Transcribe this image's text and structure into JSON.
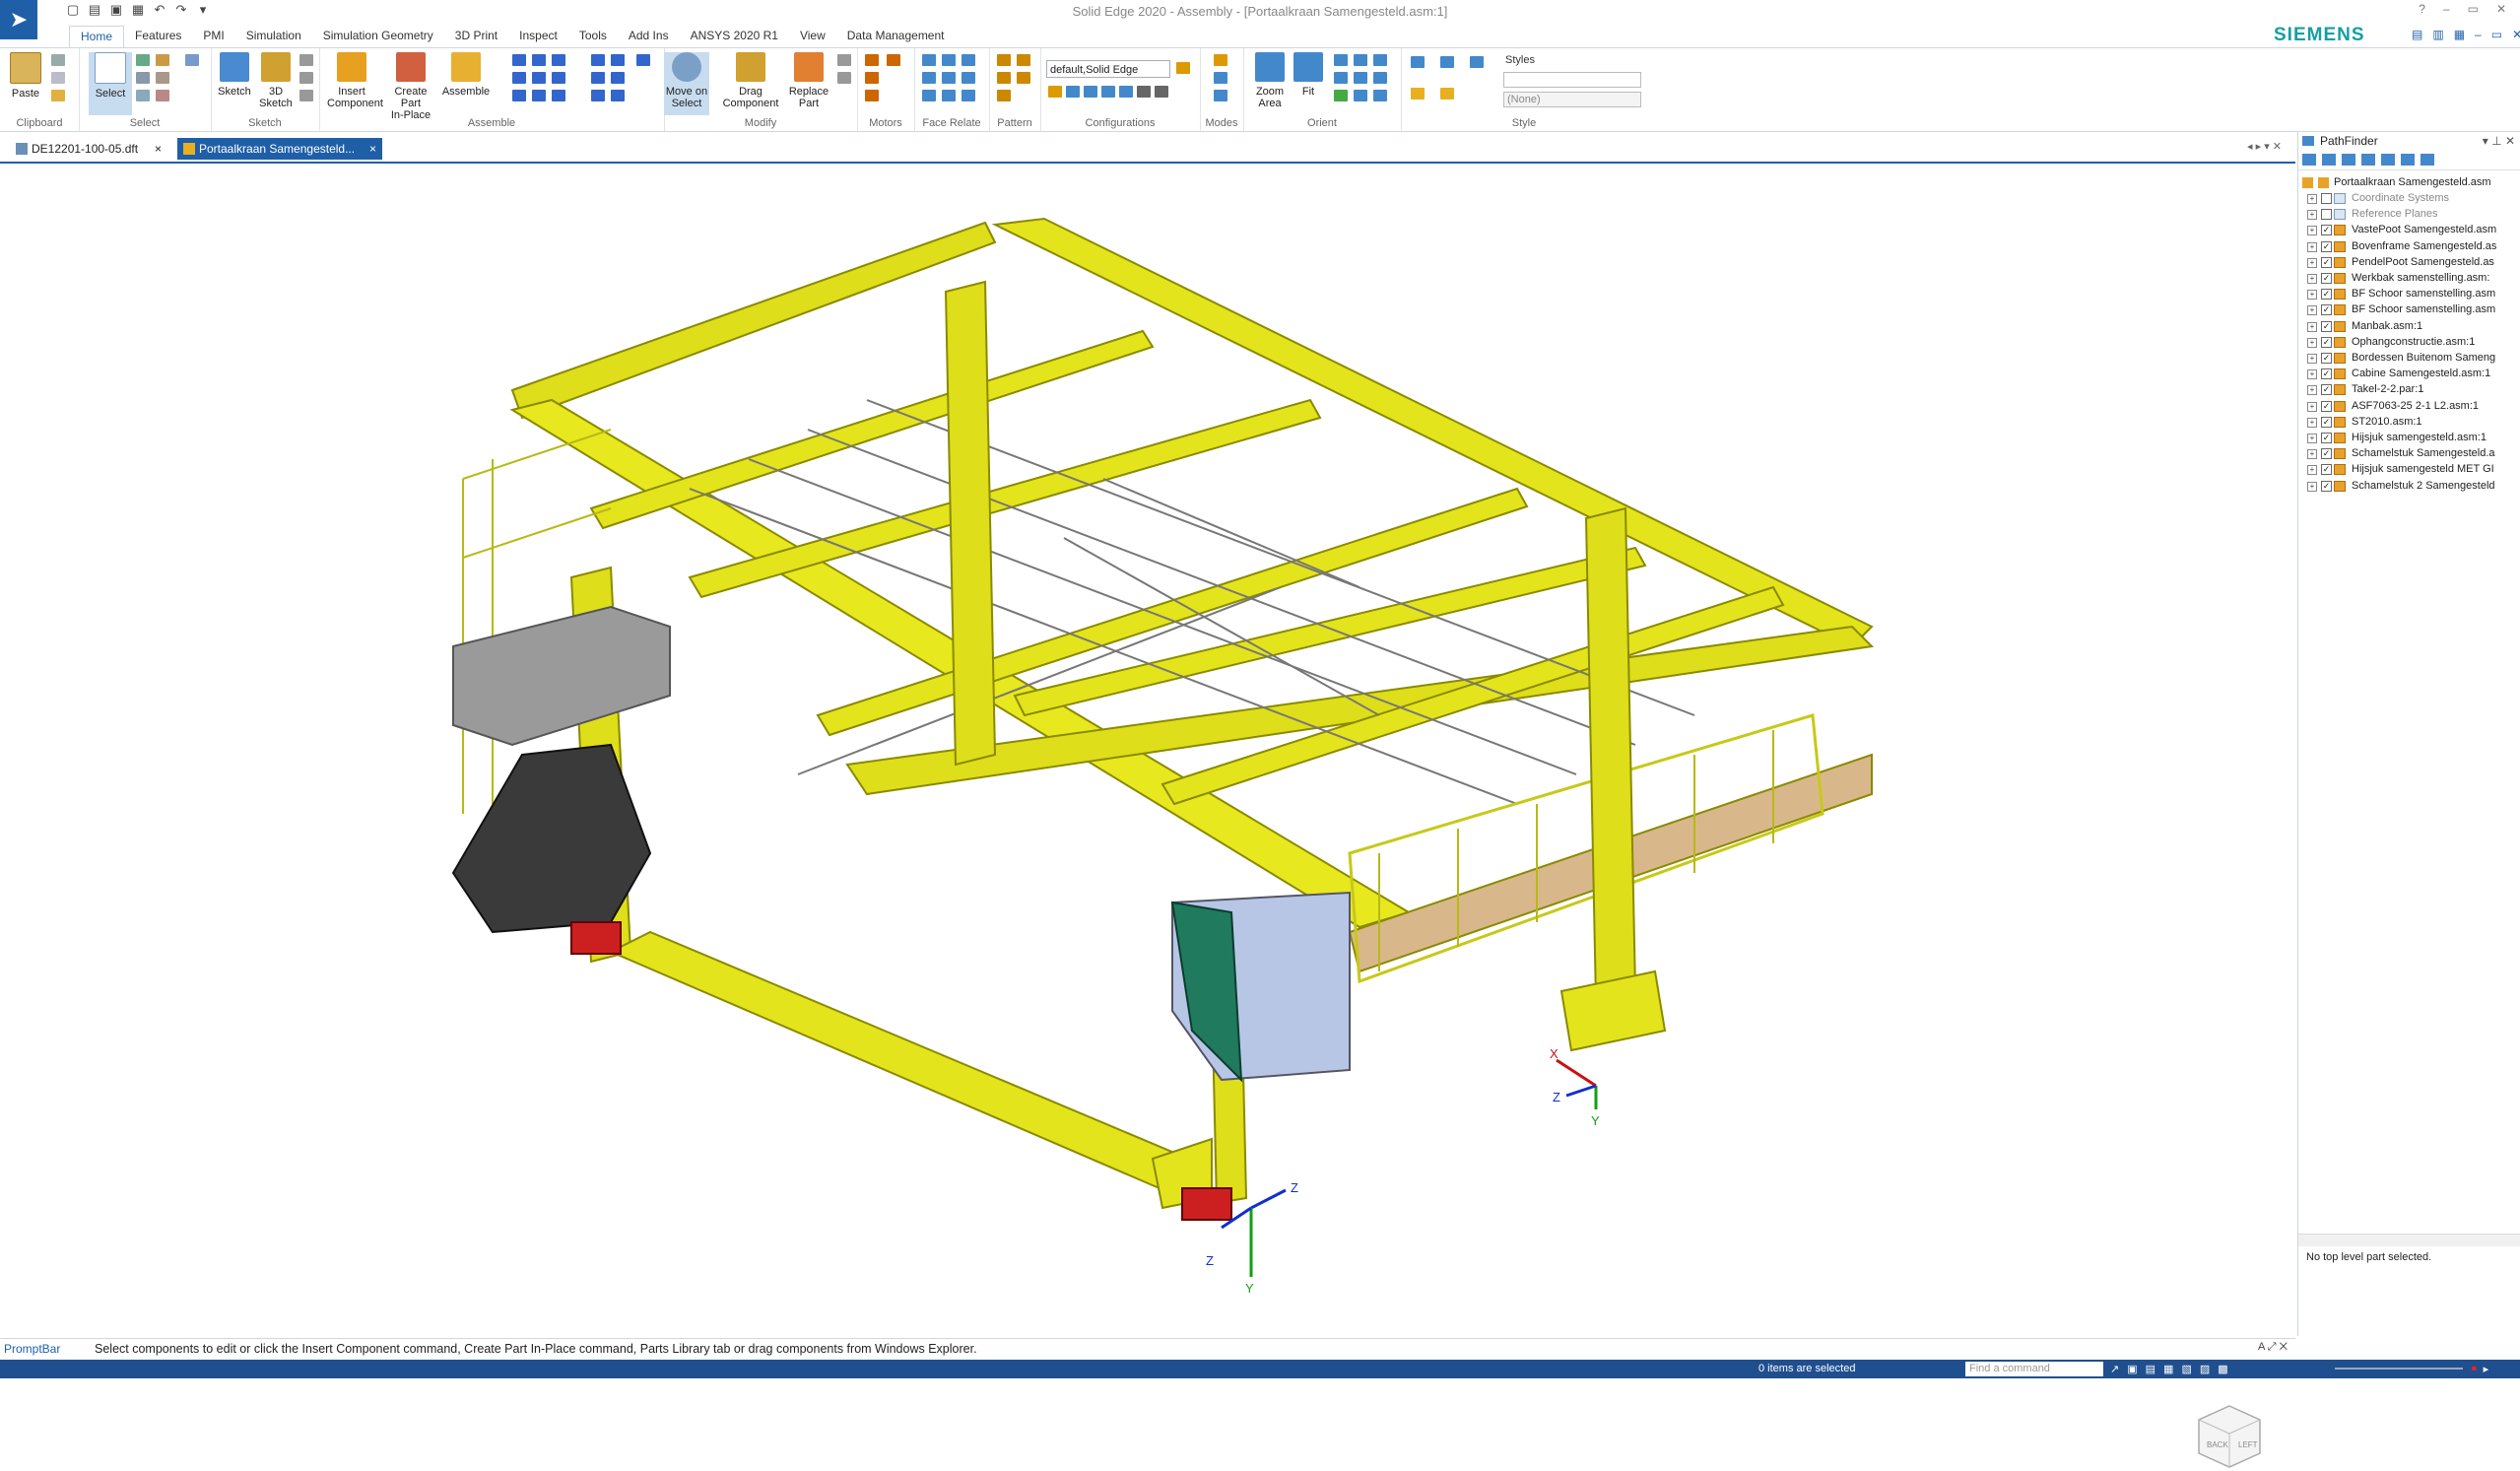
{
  "window": {
    "title": "Solid Edge 2020 - Assembly - [Portaalkraan Samengesteld.asm:1]",
    "brand": "SIEMENS"
  },
  "ribbon_tabs": [
    "Home",
    "Features",
    "PMI",
    "Simulation",
    "Simulation Geometry",
    "3D Print",
    "Inspect",
    "Tools",
    "Add Ins",
    "ANSYS 2020 R1",
    "View",
    "Data Management"
  ],
  "ribbon": {
    "groups": {
      "clipboard": "Clipboard",
      "select": "Select",
      "sketch": "Sketch",
      "assemble": "Assemble",
      "modify": "Modify",
      "motors": "Motors",
      "face_relate": "Face Relate",
      "pattern": "Pattern",
      "configurations": "Configurations",
      "modes": "Modes",
      "orient": "Orient",
      "style": "Style"
    },
    "buttons": {
      "paste": "Paste",
      "select": "Select",
      "sketch": "Sketch",
      "sketch3d_line1": "3D",
      "sketch3d_line2": "Sketch",
      "insert_line1": "Insert",
      "insert_line2": "Component",
      "create_part_line1": "Create Part",
      "create_part_line2": "In-Place",
      "assemble": "Assemble",
      "move_line1": "Move on",
      "move_line2": "Select",
      "drag_line1": "Drag",
      "drag_line2": "Component",
      "replace_line1": "Replace",
      "replace_line2": "Part",
      "zoom_line1": "Zoom",
      "zoom_line2": "Area",
      "fit": "Fit"
    },
    "configuration_value": "default,Solid Edge",
    "styles_label": "Styles",
    "style_value": "(None)"
  },
  "doc_tabs": [
    {
      "label": "DE12201-100-05.dft",
      "close": "×"
    },
    {
      "label": "Portaalkraan Samengesteld...",
      "close": "×"
    }
  ],
  "pathfinder": {
    "title": "PathFinder",
    "root": "Portaalkraan Samengesteld.asm",
    "items": [
      "Coordinate Systems",
      "Reference Planes",
      "VastePoot Samengesteld.asm",
      "Bovenframe Samengesteld.as",
      "PendelPoot Samengesteld.as",
      "Werkbak samenstelling.asm:",
      "BF Schoor samenstelling.asm",
      "BF Schoor samenstelling.asm",
      "Manbak.asm:1",
      "Ophangconstructie.asm:1",
      "Bordessen Buitenom Sameng",
      "Cabine Samengesteld.asm:1",
      "Takel-2-2.par:1",
      "ASF7063-25 2-1 L2.asm:1",
      "ST2010.asm:1",
      "Hijsjuk samengesteld.asm:1",
      "Schamelstuk Samengesteld.a",
      "Hijsjuk samengesteld MET GI",
      "Schamelstuk 2 Samengesteld"
    ],
    "status_message": "No top level part selected."
  },
  "viewcube": {
    "face1": "BACK",
    "face2": "LEFT"
  },
  "axes": {
    "x": "X",
    "y": "Y",
    "z": "Z"
  },
  "promptbar": {
    "label": "PromptBar",
    "text": "Select components to edit or click the Insert Component command, Create Part In-Place command, Parts Library tab or drag components from Windows Explorer."
  },
  "statusbar": {
    "selection": "0 items are selected",
    "find_placeholder": "Find a command"
  },
  "colors": {
    "accent": "#1f5fa8",
    "brand": "#159fa3",
    "model_yellow": "#e4e41c",
    "model_dark": "#3a3a3a"
  }
}
